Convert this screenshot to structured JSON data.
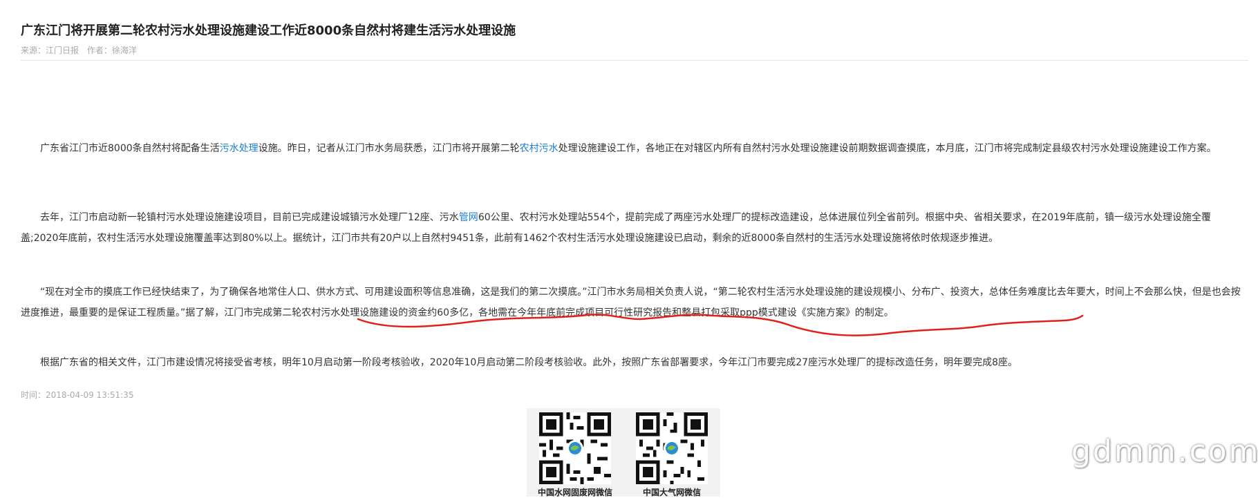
{
  "article": {
    "title": "广东江门将开展第二轮农村污水处理设施建设工作近8000条自然村将建生活污水处理设施",
    "source": "来源：江门日报",
    "author": "作者：徐海洋",
    "p1": {
      "a": "广东省江门市近8000条自然村将配备生活",
      "kw1": "污水处理",
      "b": "设施。昨日，记者从江门市水务局获悉，江门市将开展第二轮",
      "kw2": "农村污水",
      "c": "处理设施建设工作，各地正在对辖区内所有自然村污水处理设施建设前期数据调查摸底，本月底，江门市将完成制定县级农村污水处理设施建设工作方案。"
    },
    "p2": {
      "a": "去年，江门市启动新一轮镇村污水处理设施建设项目，目前已完成建设城镇污水处理厂12座、污水",
      "kw1": "管网",
      "b": "60公里、农村污水处理站554个，提前完成了两座污水处理厂的提标改造建设，总体进展位列全省前列。根据中央、省相关要求，在2019年底前，镇一级污水处理设施全覆盖;2020年底前，农村生活污水处理设施覆盖率达到80%以上。据统计，江门市共有20户以上自然村9451条，此前有1462个农村生活污水处理设施建设已启动，剩余的近8000条自然村的生活污水处理设施将依时依规逐步推进。"
    },
    "p3": "“现在对全市的摸底工作已经快结束了，为了确保各地常住人口、供水方式、可用建设面积等信息准确，这是我们的第二次摸底。”江门市水务局相关负责人说，“第二轮农村生活污水处理设施的建设规模小、分布广、投资大，总体任务难度比去年要大，时间上不会那么快，但是也会按进度推进，最重要的是保证工程质量。”据了解，江门市完成第二轮农村污水处理设施建设的资金约60多亿，各地需在今年年底前完成项目可行性研究报告和整县打包采取ppp模式建设《实施方案》的制定。",
    "p4": "根据广东省的相关文件，江门市建设情况将接受省考核，明年10月启动第一阶段考核验收，2020年10月启动第二阶段考核验收。此外，按照广东省部署要求，今年江门市要完成27座污水处理厂的提标改造任务，明年要完成8座。",
    "time": "时间：2018-04-09 13:51:35"
  },
  "qr": {
    "left_label": "中国水网固废网微信",
    "right_label": "中国大气网微信"
  },
  "watermark": "gdmm.com",
  "colors": {
    "keyword_link": "#1a7fd6",
    "annotation_stroke": "#e0201b"
  }
}
